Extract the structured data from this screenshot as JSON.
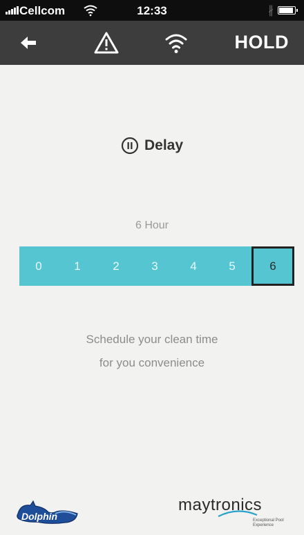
{
  "status_bar": {
    "carrier": "Cellcom",
    "time": "12:33",
    "bluetooth_symbol": "∦"
  },
  "nav": {
    "back_icon": "arrow-left-icon",
    "alert_icon": "warning-icon",
    "wifi_icon": "wifi-icon",
    "hold_label": "HOLD"
  },
  "delay": {
    "icon": "pause-circle-icon",
    "title": "Delay"
  },
  "hour_selector": {
    "current_label": "6 Hour",
    "options": [
      "0",
      "1",
      "2",
      "3",
      "4",
      "5",
      "6"
    ],
    "selected_index": 6
  },
  "description": {
    "line1": "Schedule your clean time",
    "line2": "for you convenience"
  },
  "branding": {
    "dolphin_text": "Dolphin",
    "maytronics_text": "maytronics",
    "tagline_1": "Exceptional Pool",
    "tagline_2": "Experience"
  },
  "colors": {
    "nav_bar": "#3d3d3d",
    "status_bar": "#0e0e0e",
    "accent": "#55c6d1",
    "background": "#f2f2f1"
  }
}
